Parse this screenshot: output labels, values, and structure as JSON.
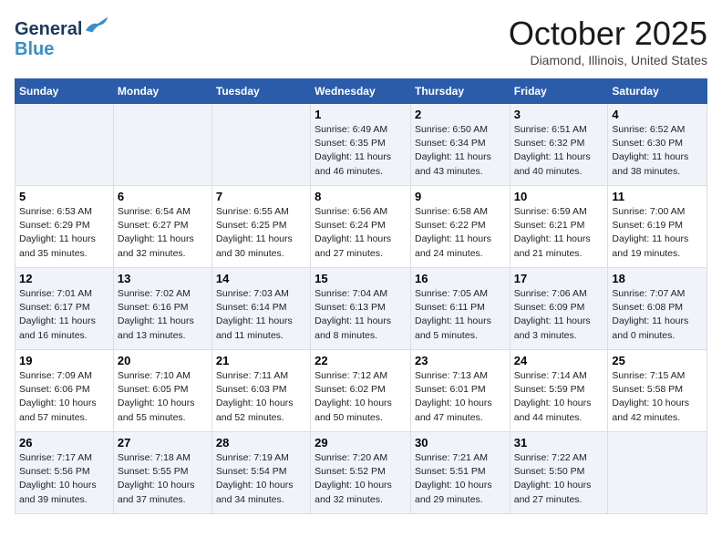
{
  "header": {
    "logo_line1": "General",
    "logo_line2": "Blue",
    "month": "October 2025",
    "location": "Diamond, Illinois, United States"
  },
  "days_of_week": [
    "Sunday",
    "Monday",
    "Tuesday",
    "Wednesday",
    "Thursday",
    "Friday",
    "Saturday"
  ],
  "weeks": [
    [
      {
        "day": "",
        "info": ""
      },
      {
        "day": "",
        "info": ""
      },
      {
        "day": "",
        "info": ""
      },
      {
        "day": "1",
        "info": "Sunrise: 6:49 AM\nSunset: 6:35 PM\nDaylight: 11 hours\nand 46 minutes."
      },
      {
        "day": "2",
        "info": "Sunrise: 6:50 AM\nSunset: 6:34 PM\nDaylight: 11 hours\nand 43 minutes."
      },
      {
        "day": "3",
        "info": "Sunrise: 6:51 AM\nSunset: 6:32 PM\nDaylight: 11 hours\nand 40 minutes."
      },
      {
        "day": "4",
        "info": "Sunrise: 6:52 AM\nSunset: 6:30 PM\nDaylight: 11 hours\nand 38 minutes."
      }
    ],
    [
      {
        "day": "5",
        "info": "Sunrise: 6:53 AM\nSunset: 6:29 PM\nDaylight: 11 hours\nand 35 minutes."
      },
      {
        "day": "6",
        "info": "Sunrise: 6:54 AM\nSunset: 6:27 PM\nDaylight: 11 hours\nand 32 minutes."
      },
      {
        "day": "7",
        "info": "Sunrise: 6:55 AM\nSunset: 6:25 PM\nDaylight: 11 hours\nand 30 minutes."
      },
      {
        "day": "8",
        "info": "Sunrise: 6:56 AM\nSunset: 6:24 PM\nDaylight: 11 hours\nand 27 minutes."
      },
      {
        "day": "9",
        "info": "Sunrise: 6:58 AM\nSunset: 6:22 PM\nDaylight: 11 hours\nand 24 minutes."
      },
      {
        "day": "10",
        "info": "Sunrise: 6:59 AM\nSunset: 6:21 PM\nDaylight: 11 hours\nand 21 minutes."
      },
      {
        "day": "11",
        "info": "Sunrise: 7:00 AM\nSunset: 6:19 PM\nDaylight: 11 hours\nand 19 minutes."
      }
    ],
    [
      {
        "day": "12",
        "info": "Sunrise: 7:01 AM\nSunset: 6:17 PM\nDaylight: 11 hours\nand 16 minutes."
      },
      {
        "day": "13",
        "info": "Sunrise: 7:02 AM\nSunset: 6:16 PM\nDaylight: 11 hours\nand 13 minutes."
      },
      {
        "day": "14",
        "info": "Sunrise: 7:03 AM\nSunset: 6:14 PM\nDaylight: 11 hours\nand 11 minutes."
      },
      {
        "day": "15",
        "info": "Sunrise: 7:04 AM\nSunset: 6:13 PM\nDaylight: 11 hours\nand 8 minutes."
      },
      {
        "day": "16",
        "info": "Sunrise: 7:05 AM\nSunset: 6:11 PM\nDaylight: 11 hours\nand 5 minutes."
      },
      {
        "day": "17",
        "info": "Sunrise: 7:06 AM\nSunset: 6:09 PM\nDaylight: 11 hours\nand 3 minutes."
      },
      {
        "day": "18",
        "info": "Sunrise: 7:07 AM\nSunset: 6:08 PM\nDaylight: 11 hours\nand 0 minutes."
      }
    ],
    [
      {
        "day": "19",
        "info": "Sunrise: 7:09 AM\nSunset: 6:06 PM\nDaylight: 10 hours\nand 57 minutes."
      },
      {
        "day": "20",
        "info": "Sunrise: 7:10 AM\nSunset: 6:05 PM\nDaylight: 10 hours\nand 55 minutes."
      },
      {
        "day": "21",
        "info": "Sunrise: 7:11 AM\nSunset: 6:03 PM\nDaylight: 10 hours\nand 52 minutes."
      },
      {
        "day": "22",
        "info": "Sunrise: 7:12 AM\nSunset: 6:02 PM\nDaylight: 10 hours\nand 50 minutes."
      },
      {
        "day": "23",
        "info": "Sunrise: 7:13 AM\nSunset: 6:01 PM\nDaylight: 10 hours\nand 47 minutes."
      },
      {
        "day": "24",
        "info": "Sunrise: 7:14 AM\nSunset: 5:59 PM\nDaylight: 10 hours\nand 44 minutes."
      },
      {
        "day": "25",
        "info": "Sunrise: 7:15 AM\nSunset: 5:58 PM\nDaylight: 10 hours\nand 42 minutes."
      }
    ],
    [
      {
        "day": "26",
        "info": "Sunrise: 7:17 AM\nSunset: 5:56 PM\nDaylight: 10 hours\nand 39 minutes."
      },
      {
        "day": "27",
        "info": "Sunrise: 7:18 AM\nSunset: 5:55 PM\nDaylight: 10 hours\nand 37 minutes."
      },
      {
        "day": "28",
        "info": "Sunrise: 7:19 AM\nSunset: 5:54 PM\nDaylight: 10 hours\nand 34 minutes."
      },
      {
        "day": "29",
        "info": "Sunrise: 7:20 AM\nSunset: 5:52 PM\nDaylight: 10 hours\nand 32 minutes."
      },
      {
        "day": "30",
        "info": "Sunrise: 7:21 AM\nSunset: 5:51 PM\nDaylight: 10 hours\nand 29 minutes."
      },
      {
        "day": "31",
        "info": "Sunrise: 7:22 AM\nSunset: 5:50 PM\nDaylight: 10 hours\nand 27 minutes."
      },
      {
        "day": "",
        "info": ""
      }
    ]
  ]
}
